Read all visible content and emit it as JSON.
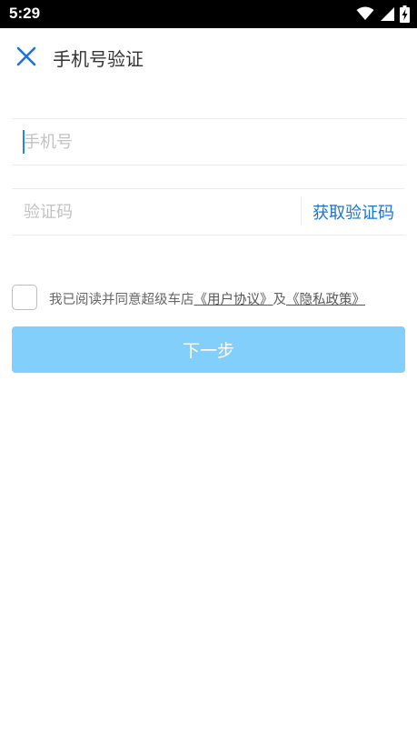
{
  "status_bar": {
    "time": "5:29",
    "icons": [
      "wifi-icon",
      "signal-icon",
      "battery-charging-icon"
    ]
  },
  "header": {
    "close_icon": "close-icon",
    "title": "手机号验证"
  },
  "form": {
    "phone": {
      "value": "",
      "placeholder": "手机号"
    },
    "code": {
      "value": "",
      "placeholder": "验证码"
    },
    "get_code_label": "获取验证码"
  },
  "agreement": {
    "checked": false,
    "prefix": "我已阅读并同意超级车店",
    "user_agreement": "《用户协议》",
    "conjunction": "及",
    "privacy_policy": "《隐私政策》"
  },
  "next_button": {
    "label": "下一步",
    "enabled": false
  },
  "colors": {
    "accent": "#1a73d9",
    "button_disabled": "#81cffa",
    "placeholder": "#c2c2c2",
    "status_bar": "#000000"
  }
}
